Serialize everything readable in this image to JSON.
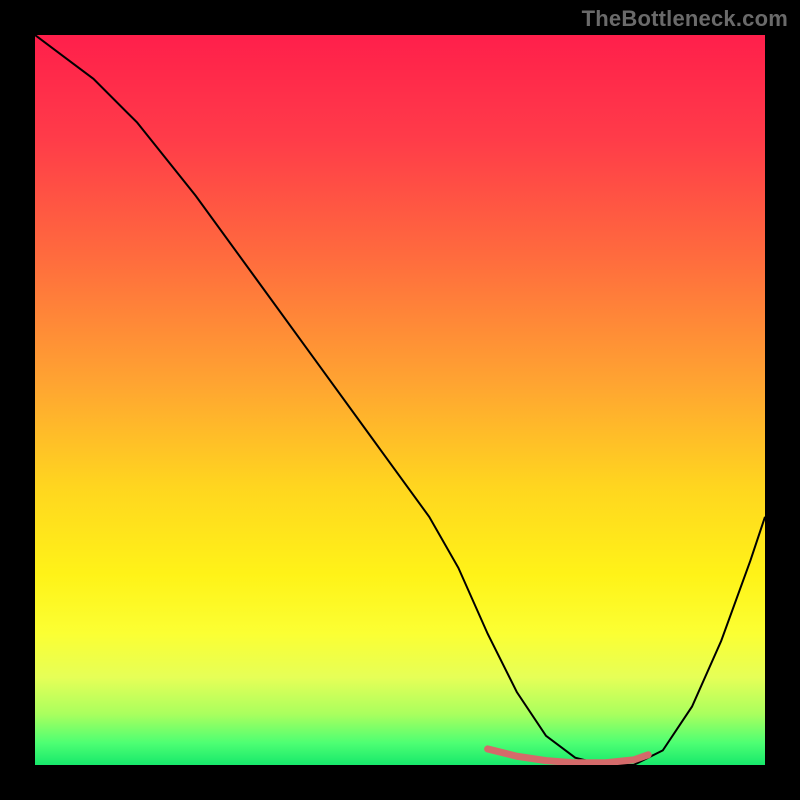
{
  "watermark": "TheBottleneck.com",
  "chart_data": {
    "type": "line",
    "title": "",
    "xlabel": "",
    "ylabel": "",
    "xlim": [
      0,
      100
    ],
    "ylim": [
      0,
      100
    ],
    "gradient_stops": [
      {
        "pct": 0,
        "color": "#ff1f4b"
      },
      {
        "pct": 14,
        "color": "#ff3b49"
      },
      {
        "pct": 30,
        "color": "#ff6a3e"
      },
      {
        "pct": 48,
        "color": "#ffa531"
      },
      {
        "pct": 62,
        "color": "#ffd61f"
      },
      {
        "pct": 74,
        "color": "#fff318"
      },
      {
        "pct": 82,
        "color": "#fbff33"
      },
      {
        "pct": 88,
        "color": "#e6ff57"
      },
      {
        "pct": 93,
        "color": "#aaff5e"
      },
      {
        "pct": 97,
        "color": "#4dff73"
      },
      {
        "pct": 100,
        "color": "#17e86b"
      }
    ],
    "series": [
      {
        "name": "bottleneck-curve",
        "stroke": "#000000",
        "stroke_width": 2,
        "x": [
          0,
          4,
          8,
          14,
          22,
          30,
          38,
          46,
          54,
          58,
          62,
          66,
          70,
          74,
          78,
          82,
          86,
          90,
          94,
          98,
          100
        ],
        "y": [
          100,
          97,
          94,
          88,
          78,
          67,
          56,
          45,
          34,
          27,
          18,
          10,
          4,
          1,
          0,
          0,
          2,
          8,
          17,
          28,
          34
        ]
      },
      {
        "name": "sweet-spot",
        "stroke": "#d46a6a",
        "stroke_width": 7,
        "x": [
          62,
          66,
          70,
          74,
          78,
          82,
          84
        ],
        "y": [
          2.2,
          1.2,
          0.6,
          0.3,
          0.3,
          0.7,
          1.4
        ]
      }
    ]
  }
}
